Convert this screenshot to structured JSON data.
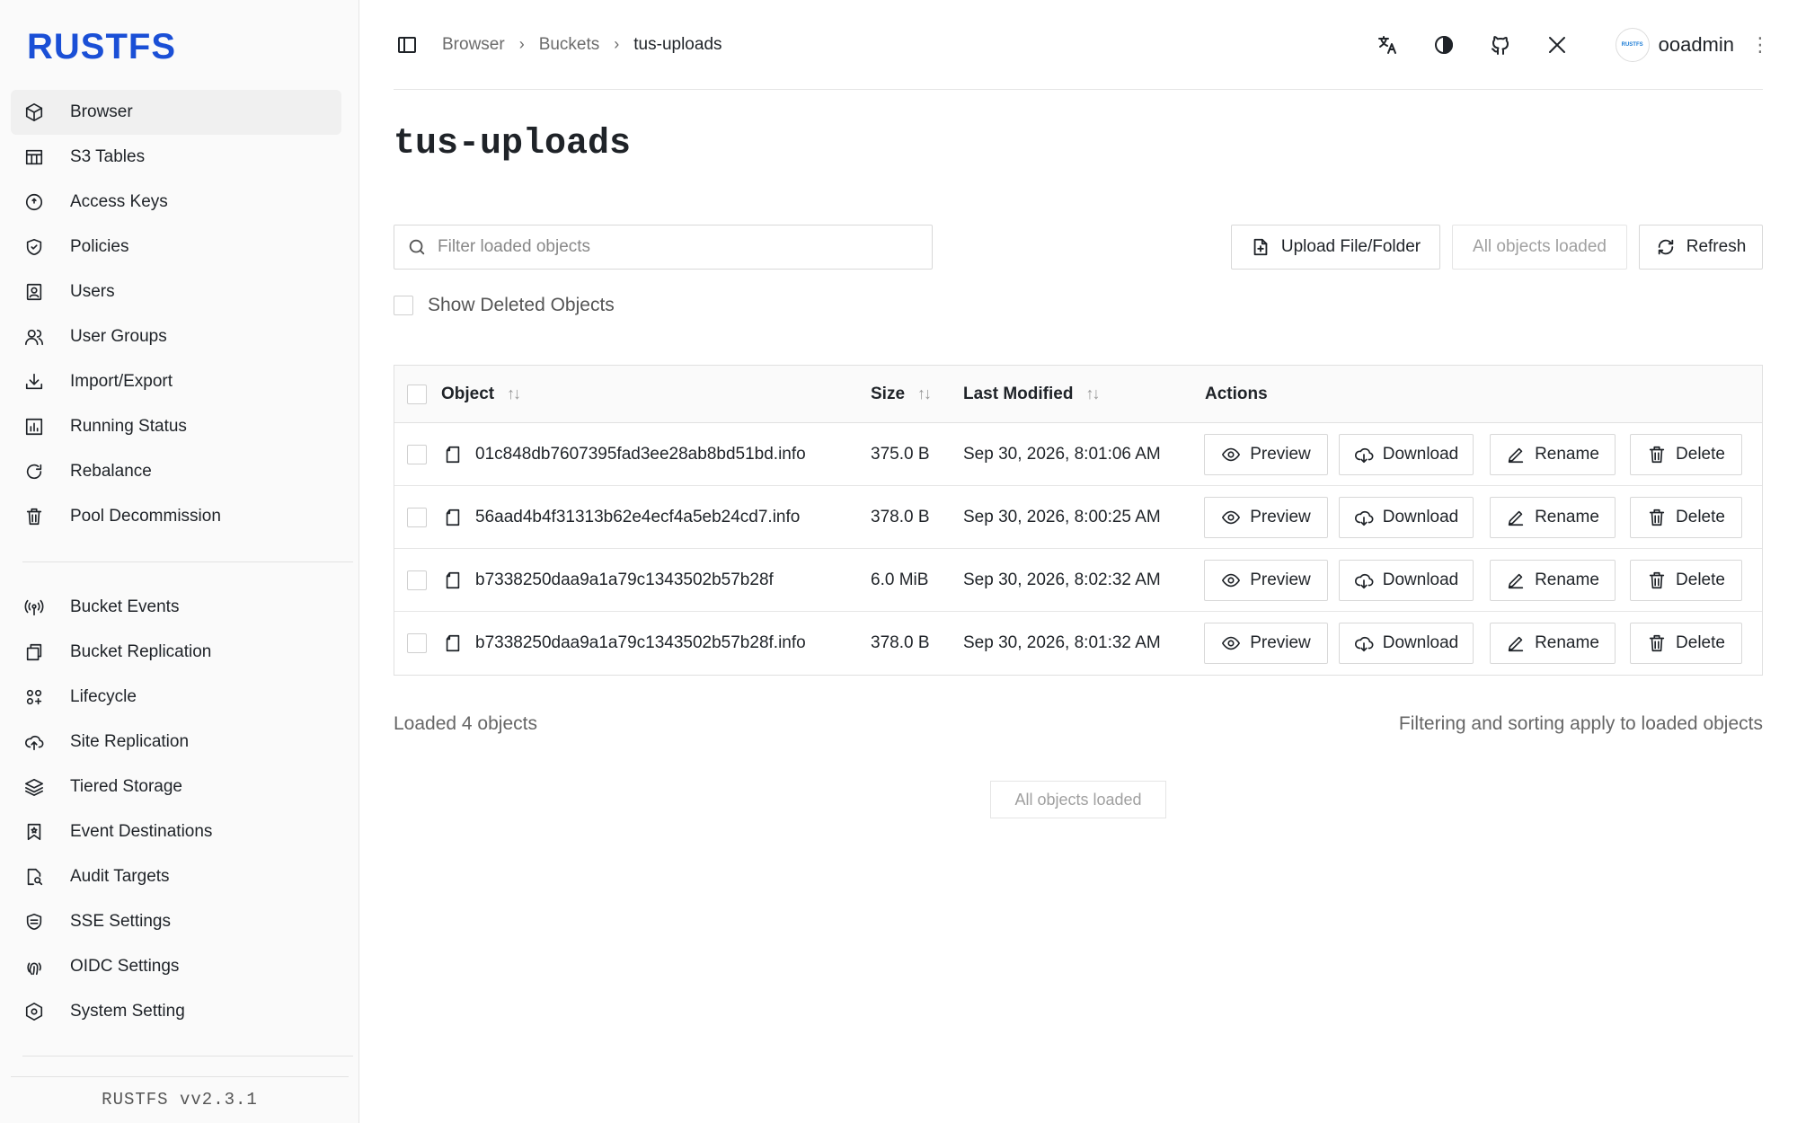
{
  "app": {
    "logo": "RUSTFS",
    "version": "RUSTFS  vv2.3.1"
  },
  "sidebar": {
    "primary": [
      {
        "label": "Browser",
        "icon": "box-icon",
        "active": true
      },
      {
        "label": "S3 Tables",
        "icon": "table-icon"
      },
      {
        "label": "Access Keys",
        "icon": "key-circle-icon"
      },
      {
        "label": "Policies",
        "icon": "shield-check-icon"
      },
      {
        "label": "Users",
        "icon": "user-file-icon"
      },
      {
        "label": "User Groups",
        "icon": "users-icon"
      },
      {
        "label": "Import/Export",
        "icon": "download-tray-icon"
      },
      {
        "label": "Running Status",
        "icon": "bar-chart-icon"
      },
      {
        "label": "Rebalance",
        "icon": "refresh-icon"
      },
      {
        "label": "Pool Decommission",
        "icon": "trash-icon"
      }
    ],
    "secondary": [
      {
        "label": "Bucket Events",
        "icon": "broadcast-icon"
      },
      {
        "label": "Bucket Replication",
        "icon": "copy-icon"
      },
      {
        "label": "Lifecycle",
        "icon": "lifecycle-icon"
      },
      {
        "label": "Site Replication",
        "icon": "cloud-upload-icon"
      },
      {
        "label": "Tiered Storage",
        "icon": "layers-icon"
      },
      {
        "label": "Event Destinations",
        "icon": "bookmark-star-icon"
      },
      {
        "label": "Audit Targets",
        "icon": "file-search-icon"
      },
      {
        "label": "SSE Settings",
        "icon": "shield-lines-icon"
      },
      {
        "label": "OIDC Settings",
        "icon": "fingerprint-icon"
      },
      {
        "label": "System Setting",
        "icon": "hexagon-gear-icon"
      }
    ]
  },
  "header": {
    "breadcrumbs": [
      "Browser",
      "Buckets",
      "tus-uploads"
    ],
    "user": {
      "name": "ooadmin",
      "avatar_text": "RUSTFS"
    }
  },
  "page": {
    "title": "tus-uploads",
    "filter_placeholder": "Filter loaded objects",
    "upload_label": "Upload File/Folder",
    "all_loaded_label": "All objects loaded",
    "refresh_label": "Refresh",
    "show_deleted_label": "Show Deleted Objects"
  },
  "table": {
    "columns": {
      "object": "Object",
      "size": "Size",
      "modified": "Last Modified",
      "actions": "Actions"
    },
    "actions": {
      "preview": "Preview",
      "download": "Download",
      "rename": "Rename",
      "delete": "Delete"
    },
    "rows": [
      {
        "name": "01c848db7607395fad3ee28ab8bd51bd.info",
        "size": "375.0 B",
        "modified": "Sep 30, 2026, 8:01:06 AM"
      },
      {
        "name": "56aad4b4f31313b62e4ecf4a5eb24cd7.info",
        "size": "378.0 B",
        "modified": "Sep 30, 2026, 8:00:25 AM"
      },
      {
        "name": "b7338250daa9a1a79c1343502b57b28f",
        "size": "6.0 MiB",
        "modified": "Sep 30, 2026, 8:02:32 AM"
      },
      {
        "name": "b7338250daa9a1a79c1343502b57b28f.info",
        "size": "378.0 B",
        "modified": "Sep 30, 2026, 8:01:32 AM"
      }
    ]
  },
  "footer": {
    "loaded_count": "Loaded 4 objects",
    "hint": "Filtering and sorting apply to loaded objects",
    "all_loaded": "All objects loaded"
  },
  "colors": {
    "brand": "#1a4fd6"
  }
}
